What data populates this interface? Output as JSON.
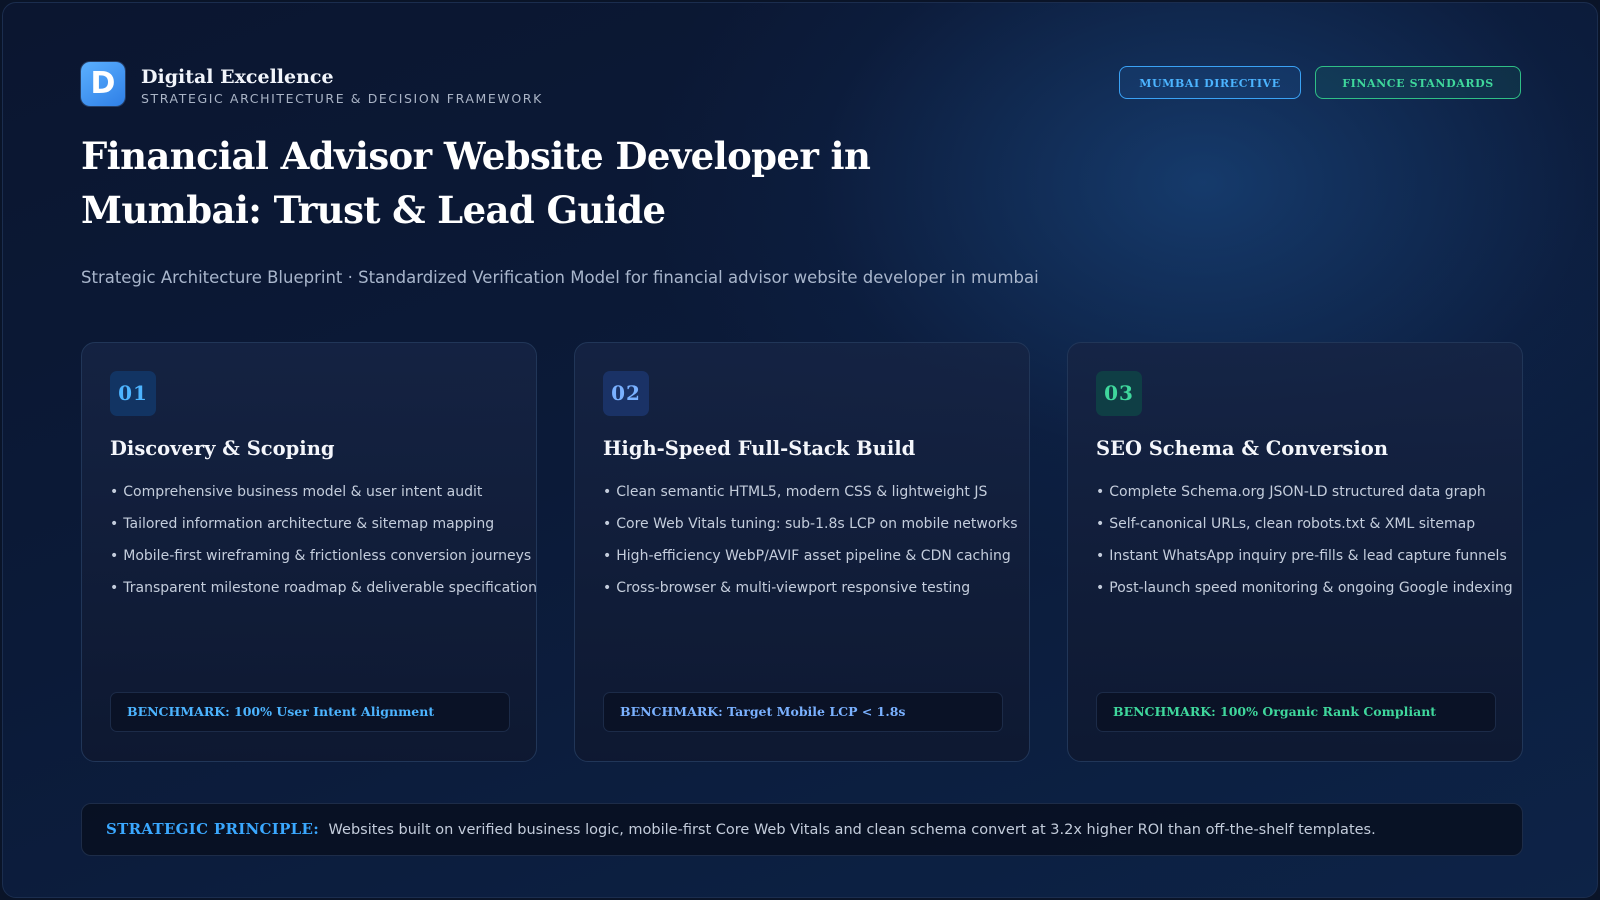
{
  "brand": {
    "logo_letter": "D",
    "name": "Digital Excellence",
    "tagline": "STRATEGIC ARCHITECTURE & DECISION FRAMEWORK"
  },
  "badges": [
    {
      "label": "MUMBAI DIRECTIVE",
      "color": "#3aa2f5"
    },
    {
      "label": "FINANCE STANDARDS",
      "color": "#2fbf86"
    }
  ],
  "header": {
    "title": "Financial Advisor Website Developer in Mumbai: Trust & Lead Guide",
    "subtitle": "Strategic Architecture Blueprint · Standardized Verification Model for financial advisor website developer in mumbai"
  },
  "cards": [
    {
      "number": "01",
      "title": "Discovery & Scoping",
      "items": [
        "Comprehensive business model & user intent audit",
        "Tailored information architecture & sitemap mapping",
        "Mobile-first wireframing & frictionless conversion journeys",
        "Transparent milestone roadmap & deliverable specification"
      ],
      "benchmark": "BENCHMARK: 100% User Intent Alignment",
      "accent": "#4cb4ff"
    },
    {
      "number": "02",
      "title": "High-Speed Full-Stack Build",
      "items": [
        "Clean semantic HTML5, modern CSS & lightweight JS",
        "Core Web Vitals tuning: sub-1.8s LCP on mobile networks",
        "High-efficiency WebP/AVIF asset pipeline & CDN caching",
        "Cross-browser & multi-viewport responsive testing"
      ],
      "benchmark": "BENCHMARK: Target Mobile LCP < 1.8s",
      "accent": "#7ab1ff"
    },
    {
      "number": "03",
      "title": "SEO Schema & Conversion",
      "items": [
        "Complete Schema.org JSON-LD structured data graph",
        "Self-canonical URLs, clean robots.txt & XML sitemap",
        "Instant WhatsApp inquiry pre-fills & lead capture funnels",
        "Post-launch speed monitoring & ongoing Google indexing"
      ],
      "benchmark": "BENCHMARK: 100% Organic Rank Compliant",
      "accent": "#3fd79c"
    }
  ],
  "principle": {
    "label": "STRATEGIC PRINCIPLE:",
    "text": "Websites built on verified business logic, mobile-first Core Web Vitals and clean schema convert at 3.2x higher ROI than off-the-shelf templates."
  }
}
